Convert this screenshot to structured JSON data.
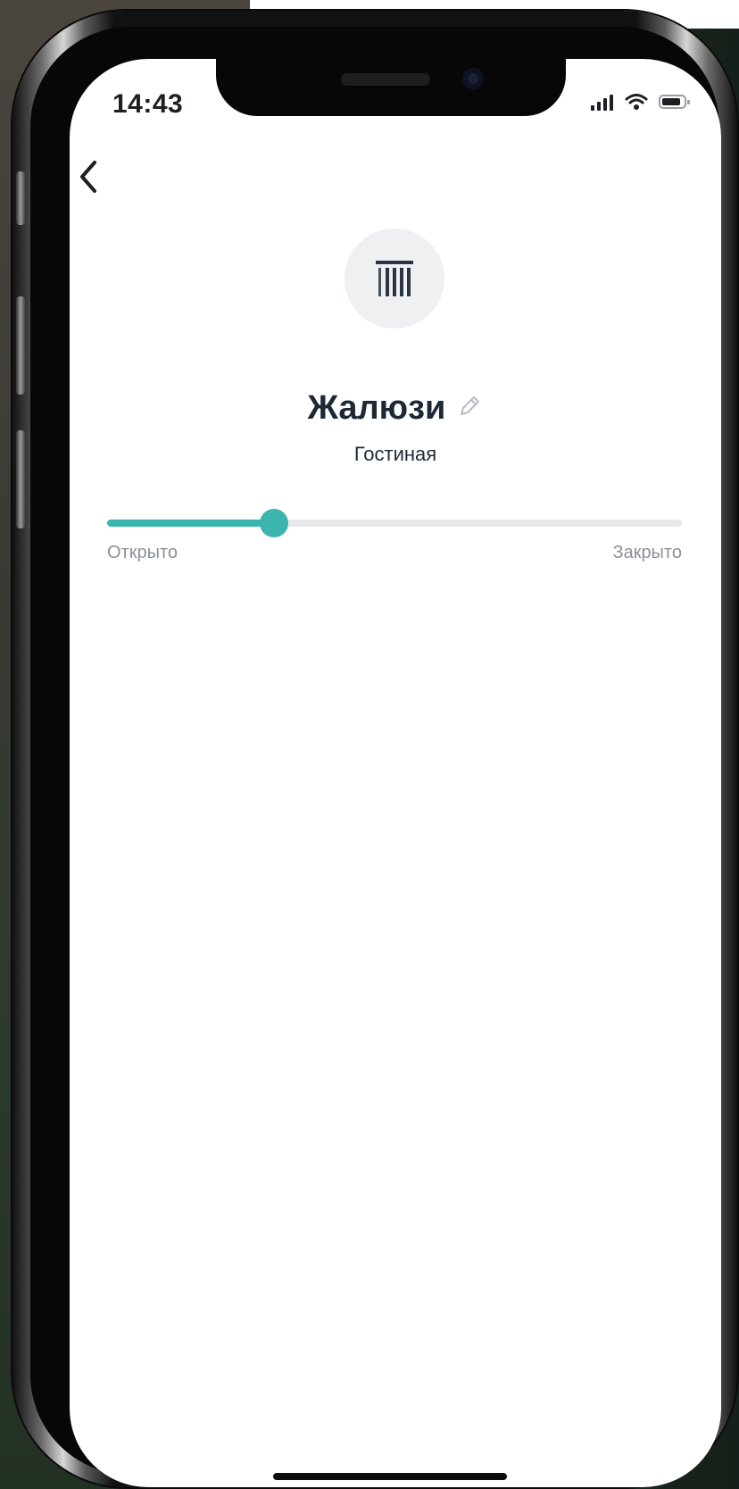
{
  "status_bar": {
    "time": "14:43"
  },
  "device": {
    "name": "Жалюзи",
    "room": "Гостиная",
    "icon": "blinds-icon"
  },
  "slider": {
    "position_percent": 29,
    "label_min": "Открыто",
    "label_max": "Закрыто"
  },
  "colors": {
    "accent": "#3bb5ae",
    "title": "#1d2836",
    "muted": "#8a9099",
    "track": "#e6e7e9",
    "icon_bg": "#eff0f2"
  },
  "icons": {
    "back": "chevron-left-icon",
    "edit": "pencil-icon",
    "signal": "cellular-signal-icon",
    "wifi": "wifi-icon",
    "battery": "battery-icon"
  }
}
